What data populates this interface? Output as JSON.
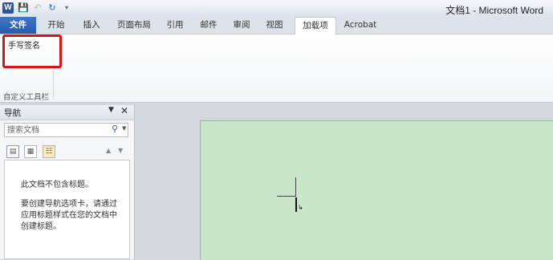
{
  "window": {
    "title": "文档1 - Microsoft Word"
  },
  "quick_access": {
    "word_logo": "W",
    "save_icon": "save-icon",
    "undo_icon": "undo-icon",
    "redo_icon": "redo-icon",
    "menu_icon": "chevron-down-icon"
  },
  "tabs": [
    {
      "label": "文件"
    },
    {
      "label": "开始"
    },
    {
      "label": "插入"
    },
    {
      "label": "页面布局"
    },
    {
      "label": "引用"
    },
    {
      "label": "邮件"
    },
    {
      "label": "审阅"
    },
    {
      "label": "视图"
    },
    {
      "label": "加载项"
    },
    {
      "label": "Acrobat"
    }
  ],
  "ribbon": {
    "item_label": "手写签名",
    "group_label": "自定义工具栏"
  },
  "nav": {
    "title": "导航",
    "search_placeholder": "搜索文档",
    "message_no_headings": "此文档不包含标题。",
    "message_instructions": "要创建导航选项卡，请通过应用标题样式在您的文档中创建标题。"
  },
  "colors": {
    "file_tab": "#2a5aa8",
    "highlight_box": "#d9141b",
    "page_background": "#c8e6ca"
  }
}
